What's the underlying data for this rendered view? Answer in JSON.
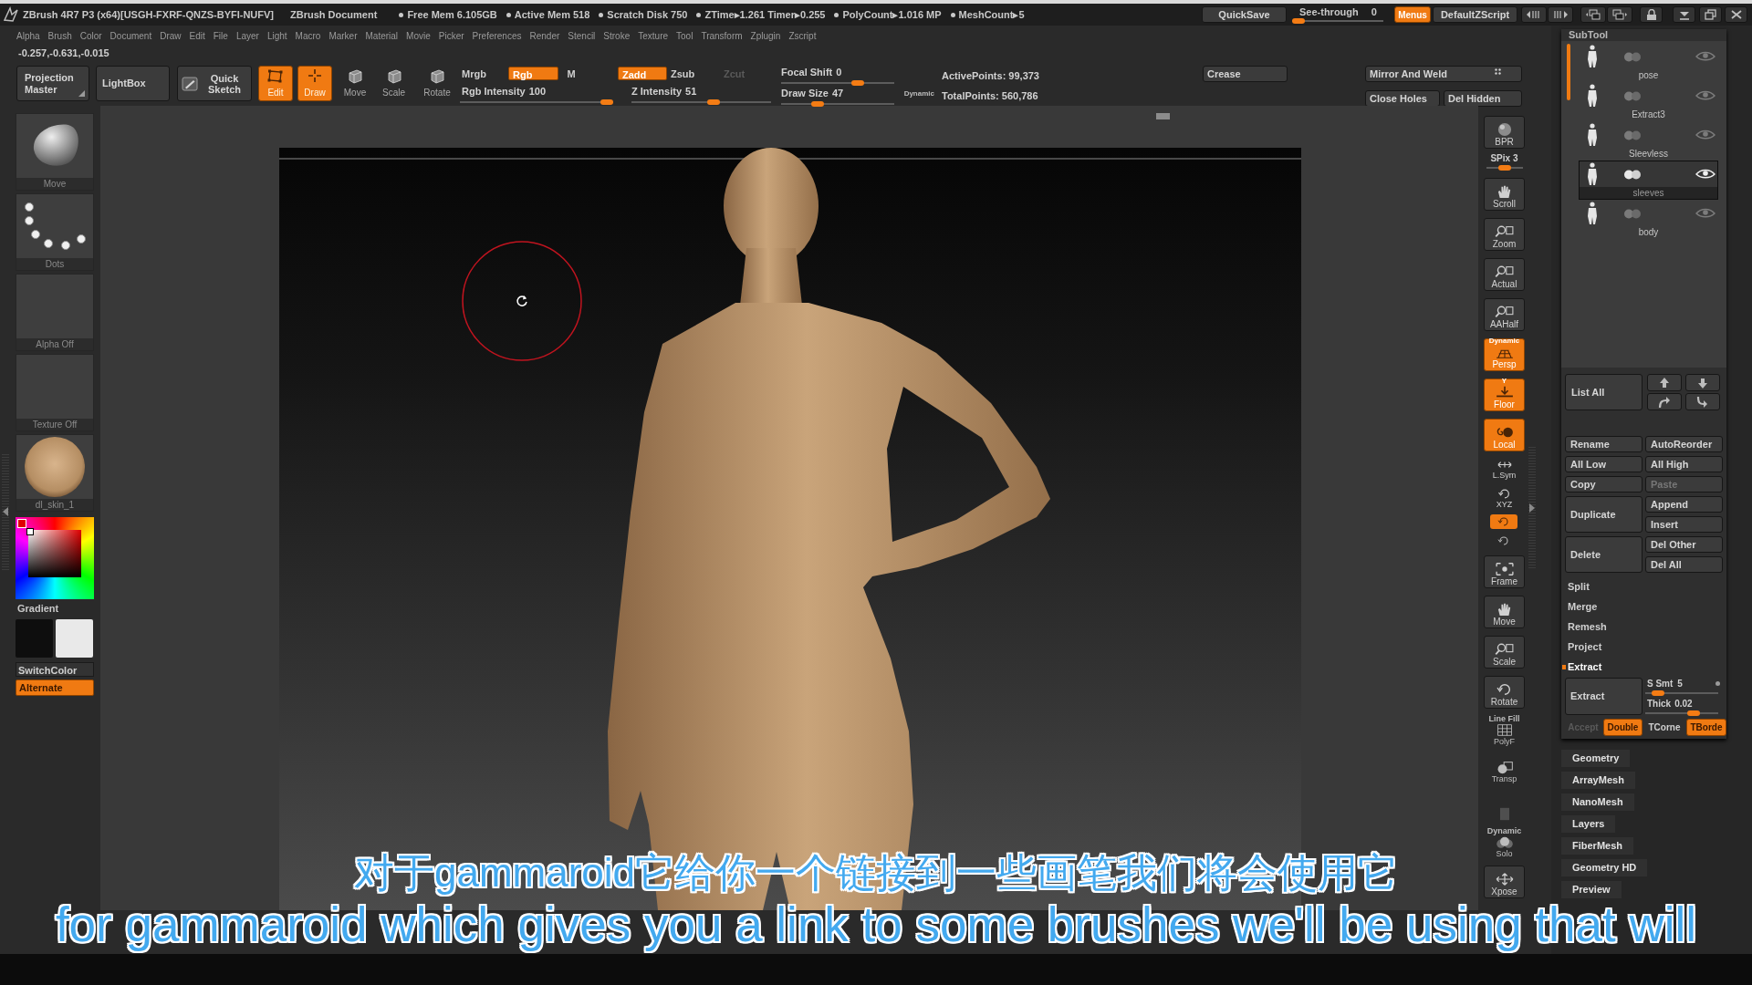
{
  "title_bar": {
    "app": "ZBrush 4R7 P3 (x64)[USGH-FXRF-QNZS-BYFI-NUFV]",
    "document": "ZBrush Document",
    "stats": [
      "Free Mem 6.105GB",
      "Active Mem 518",
      "Scratch Disk 750",
      "ZTime▸1.261 Timer▸0.255",
      "PolyCount▸1.016 MP",
      "MeshCount▸5"
    ],
    "quicksave": "QuickSave",
    "see_through": {
      "label": "See-through",
      "value": "0",
      "level": 0
    },
    "menus": {
      "label": "Menus",
      "on": true
    },
    "script": "DefaultZScript"
  },
  "menu_bar": [
    "Alpha",
    "Brush",
    "Color",
    "Document",
    "Draw",
    "Edit",
    "File",
    "Layer",
    "Light",
    "Macro",
    "Marker",
    "Material",
    "Movie",
    "Picker",
    "Preferences",
    "Render",
    "Stencil",
    "Stroke",
    "Texture",
    "Tool",
    "Transform",
    "Zplugin",
    "Zscript"
  ],
  "coordinates": "-0.257,-0.631,-0.015",
  "top_shelf": {
    "projection_master": "Projection Master",
    "lightbox": "LightBox",
    "quick_sketch": "Quick Sketch",
    "transform_modes": [
      {
        "label": "Edit",
        "on": true
      },
      {
        "label": "Draw",
        "on": true
      },
      {
        "label": "Move",
        "on": false
      },
      {
        "label": "Scale",
        "on": false
      },
      {
        "label": "Rotate",
        "on": false
      }
    ],
    "color_modes": [
      {
        "label": "Mrgb",
        "on": false
      },
      {
        "label": "Rgb",
        "on": true
      },
      {
        "label": "M",
        "on": false
      }
    ],
    "rgb_intensity": {
      "label": "Rgb Intensity",
      "value": "100",
      "level": 1
    },
    "sculpt_modes": [
      {
        "label": "Zadd",
        "on": true,
        "disabled": false
      },
      {
        "label": "Zsub",
        "on": false,
        "disabled": false
      },
      {
        "label": "Zcut",
        "on": false,
        "disabled": true
      }
    ],
    "z_intensity": {
      "label": "Z Intensity",
      "value": "51",
      "level": 0.6
    },
    "focal_shift": {
      "label": "Focal Shift",
      "value": "0",
      "level": 0.7
    },
    "draw_size": {
      "label": "Draw Size",
      "value": "47",
      "level": 0.3
    },
    "dynamic": "Dynamic",
    "active_points": "ActivePoints: 99,373",
    "total_points": "TotalPoints: 560,786",
    "crease": "Crease",
    "mirror_and_weld": "Mirror And Weld",
    "close_holes": "Close Holes",
    "del_hidden": "Del Hidden"
  },
  "left_shelf": {
    "tiles": [
      {
        "label": "Move",
        "kind": "brush"
      },
      {
        "label": "Dots",
        "kind": "stroke"
      },
      {
        "label": "Alpha Off",
        "kind": "alpha"
      },
      {
        "label": "Texture Off",
        "kind": "texture"
      },
      {
        "label": "dl_skin_1",
        "kind": "material"
      }
    ],
    "gradient": "Gradient",
    "color_swatches": [
      {
        "color": "#0e0e0e"
      },
      {
        "color": "#e9e9e9"
      }
    ],
    "switch_color": "SwitchColor",
    "alternate": {
      "label": "Alternate",
      "on": true
    }
  },
  "right_shelf": [
    {
      "label": "BPR",
      "kind": "tile",
      "on": false,
      "disabled": false
    },
    {
      "label": "SPix",
      "value": "3",
      "kind": "slider",
      "level": 0.5
    },
    {
      "label": "Scroll",
      "kind": "tile",
      "on": false,
      "disabled": false
    },
    {
      "label": "Zoom",
      "kind": "tile",
      "on": false,
      "disabled": false
    },
    {
      "label": "Actual",
      "kind": "tile",
      "on": false,
      "disabled": false
    },
    {
      "label": "AAHalf",
      "kind": "tile",
      "on": false,
      "disabled": false
    },
    {
      "label": "Persp",
      "caption": "Dynamic",
      "kind": "tile",
      "on": true,
      "disabled": false
    },
    {
      "label": "Floor",
      "caption": "Y",
      "kind": "tile",
      "on": true,
      "disabled": false
    },
    {
      "label": "Local",
      "kind": "tile",
      "on": true,
      "disabled": false
    },
    {
      "label": "L.Sym",
      "kind": "mini",
      "on": false,
      "disabled": false
    },
    {
      "label": "XYZ",
      "kind": "mini",
      "on": false,
      "disabled": false
    },
    {
      "kind": "small",
      "on": true,
      "disabled": false
    },
    {
      "kind": "small",
      "on": false,
      "disabled": false
    },
    {
      "label": "Frame",
      "kind": "tile",
      "on": false,
      "disabled": false
    },
    {
      "label": "Move",
      "kind": "tile",
      "on": false,
      "disabled": false
    },
    {
      "label": "Scale",
      "kind": "tile",
      "on": false,
      "disabled": false
    },
    {
      "label": "Rotate",
      "kind": "tile",
      "on": false,
      "disabled": false
    },
    {
      "label": "PolyF",
      "caption": "Line Fill",
      "kind": "flat",
      "on": false,
      "disabled": false
    },
    {
      "label": "Transp",
      "kind": "flat",
      "on": false,
      "disabled": false
    },
    {
      "kind": "flat",
      "on": false,
      "disabled": true
    },
    {
      "label": "Solo",
      "caption": "Dynamic",
      "kind": "flat",
      "on": false,
      "disabled": false
    },
    {
      "label": "Xpose",
      "kind": "tile",
      "on": false,
      "disabled": false
    }
  ],
  "tray": {
    "subtool": {
      "title": "SubTool",
      "items": [
        {
          "name": "pose",
          "selected": false
        },
        {
          "name": "Extract3",
          "selected": false
        },
        {
          "name": "Sleevless",
          "selected": false
        },
        {
          "name": "sleeves",
          "selected": true
        },
        {
          "name": "body",
          "selected": false
        }
      ]
    },
    "list_all": "List All",
    "action_rows": [
      {
        "left": {
          "label": "Rename",
          "disabled": false
        },
        "right": [
          {
            "label": "AutoReorder",
            "disabled": false
          }
        ]
      },
      {
        "left": {
          "label": "All Low",
          "disabled": false
        },
        "right": [
          {
            "label": "All High",
            "disabled": false
          }
        ]
      },
      {
        "left": {
          "label": "Copy",
          "disabled": false
        },
        "right": [
          {
            "label": "Paste",
            "disabled": true
          }
        ]
      },
      {
        "left": {
          "label": "Duplicate",
          "disabled": false
        },
        "right": [
          {
            "label": "Append",
            "disabled": false
          },
          {
            "label": "Insert",
            "disabled": false
          }
        ]
      },
      {
        "left": {
          "label": "Delete",
          "disabled": false
        },
        "right": [
          {
            "label": "Del Other",
            "disabled": false
          },
          {
            "label": "Del All",
            "disabled": false
          }
        ]
      }
    ],
    "sections": [
      {
        "label": "Split",
        "expanded": false
      },
      {
        "label": "Merge",
        "expanded": false
      },
      {
        "label": "Remesh",
        "expanded": false
      },
      {
        "label": "Project",
        "expanded": false
      },
      {
        "label": "Extract",
        "expanded": true
      }
    ],
    "extract": {
      "button": "Extract",
      "s_smt": {
        "label": "S Smt",
        "value": "5",
        "level": 0.1
      },
      "thick": {
        "label": "Thick",
        "value": "0.02",
        "level": 0.7
      },
      "toggles": [
        {
          "label": "Accept",
          "on": false,
          "disabled": true
        },
        {
          "label": "Double",
          "on": true,
          "disabled": false
        },
        {
          "label": "TCorne",
          "on": false,
          "disabled": false
        },
        {
          "label": "TBorde",
          "on": true,
          "disabled": false
        }
      ]
    },
    "palettes": [
      "Geometry",
      "ArrayMesh",
      "NanoMesh",
      "Layers",
      "FiberMesh",
      "Geometry HD",
      "Preview"
    ]
  },
  "subtitles": [
    "对于gammaroid它给你一个链接到一些画笔我们将会使用它",
    "for gammaroid which gives you a link to some brushes we'll be using that will"
  ]
}
